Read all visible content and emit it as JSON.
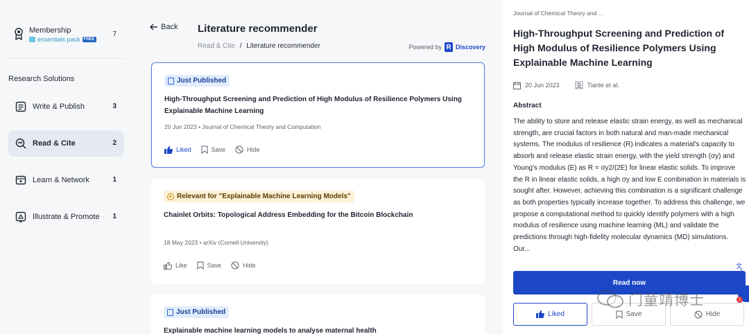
{
  "sidebar": {
    "membership": {
      "title": "Membership",
      "subtitle": "essentials pack",
      "badge": "FREE",
      "count": "7"
    },
    "section_title": "Research Solutions",
    "items": [
      {
        "label": "Write & Publish",
        "count": "3",
        "icon": "write-icon"
      },
      {
        "label": "Read & Cite",
        "count": "2",
        "icon": "read-cite-icon",
        "active": true
      },
      {
        "label": "Learn & Network",
        "count": "1",
        "icon": "learn-icon"
      },
      {
        "label": "Illustrate & Promote",
        "count": "1",
        "icon": "illustrate-icon"
      }
    ]
  },
  "main": {
    "back_label": "Back",
    "title": "Literature recommender",
    "breadcrumb": {
      "parent": "Read & Cite",
      "separator": "/",
      "current": "Literature recommender"
    },
    "powered_by": "Powered by",
    "powered_brand": "Discovery",
    "powered_logo_letter": "R",
    "cards": [
      {
        "badge": "Just Published",
        "title": "High-Throughput Screening and Prediction of High Modulus of Resilience Polymers Using Explainable Machine Learning",
        "meta": "20 Jun 2023 • Journal of Chemical Theory and Computation",
        "like": "Liked",
        "save": "Save",
        "hide": "Hide"
      },
      {
        "badge": "Relevant for \"Explainable Machine Learning Models\"",
        "title": "Chainlet Orbits: Topological Address Embedding for the Bitcoin Blockchain",
        "meta": "18 May 2023 • arXiv (Cornell University)",
        "like": "Like",
        "save": "Save",
        "hide": "Hide"
      },
      {
        "badge": "Just Published",
        "title": "Explainable machine learning models to analyse maternal health"
      }
    ]
  },
  "detail": {
    "journal": "Journal of Chemical Theory and ...",
    "title": "High-Throughput Screening and Prediction of High Modulus of Resilience Polymers Using Explainable Machine Learning",
    "date": "20 Jun 2023",
    "authors": "Tianle et al.",
    "abstract_heading": "Abstract",
    "abstract": "The ability to store and release elastic strain energy, as well as mechanical strength, are crucial factors in both natural and man-made mechanical systems. The modulus of resilience (R) indicates a material's capacity to absorb and release elastic strain energy, with the yield strength (σy) and Young's modulus (E) as R = σy2/(2E) for linear elastic solids. To improve the R in linear elastic solids, a high σy and low E combination in materials is sought after. However, achieving this combination is a significant challenge as both properties typically increase together. To address this challenge, we propose a computational method to quickly identify polymers with a high modulus of resilience using machine learning (ML) and validate the predictions through high-fidelity molecular dynamics (MD) simulations. Our...",
    "read_now": "Read now",
    "liked": "Liked",
    "save": "Save",
    "hide": "Hide",
    "notif_count": "1"
  },
  "watermark": "门童靖博士",
  "colors": {
    "accent": "#1c47c6",
    "sidebar_bg": "#f6f7f9",
    "active_nav": "#e4e9f2"
  }
}
